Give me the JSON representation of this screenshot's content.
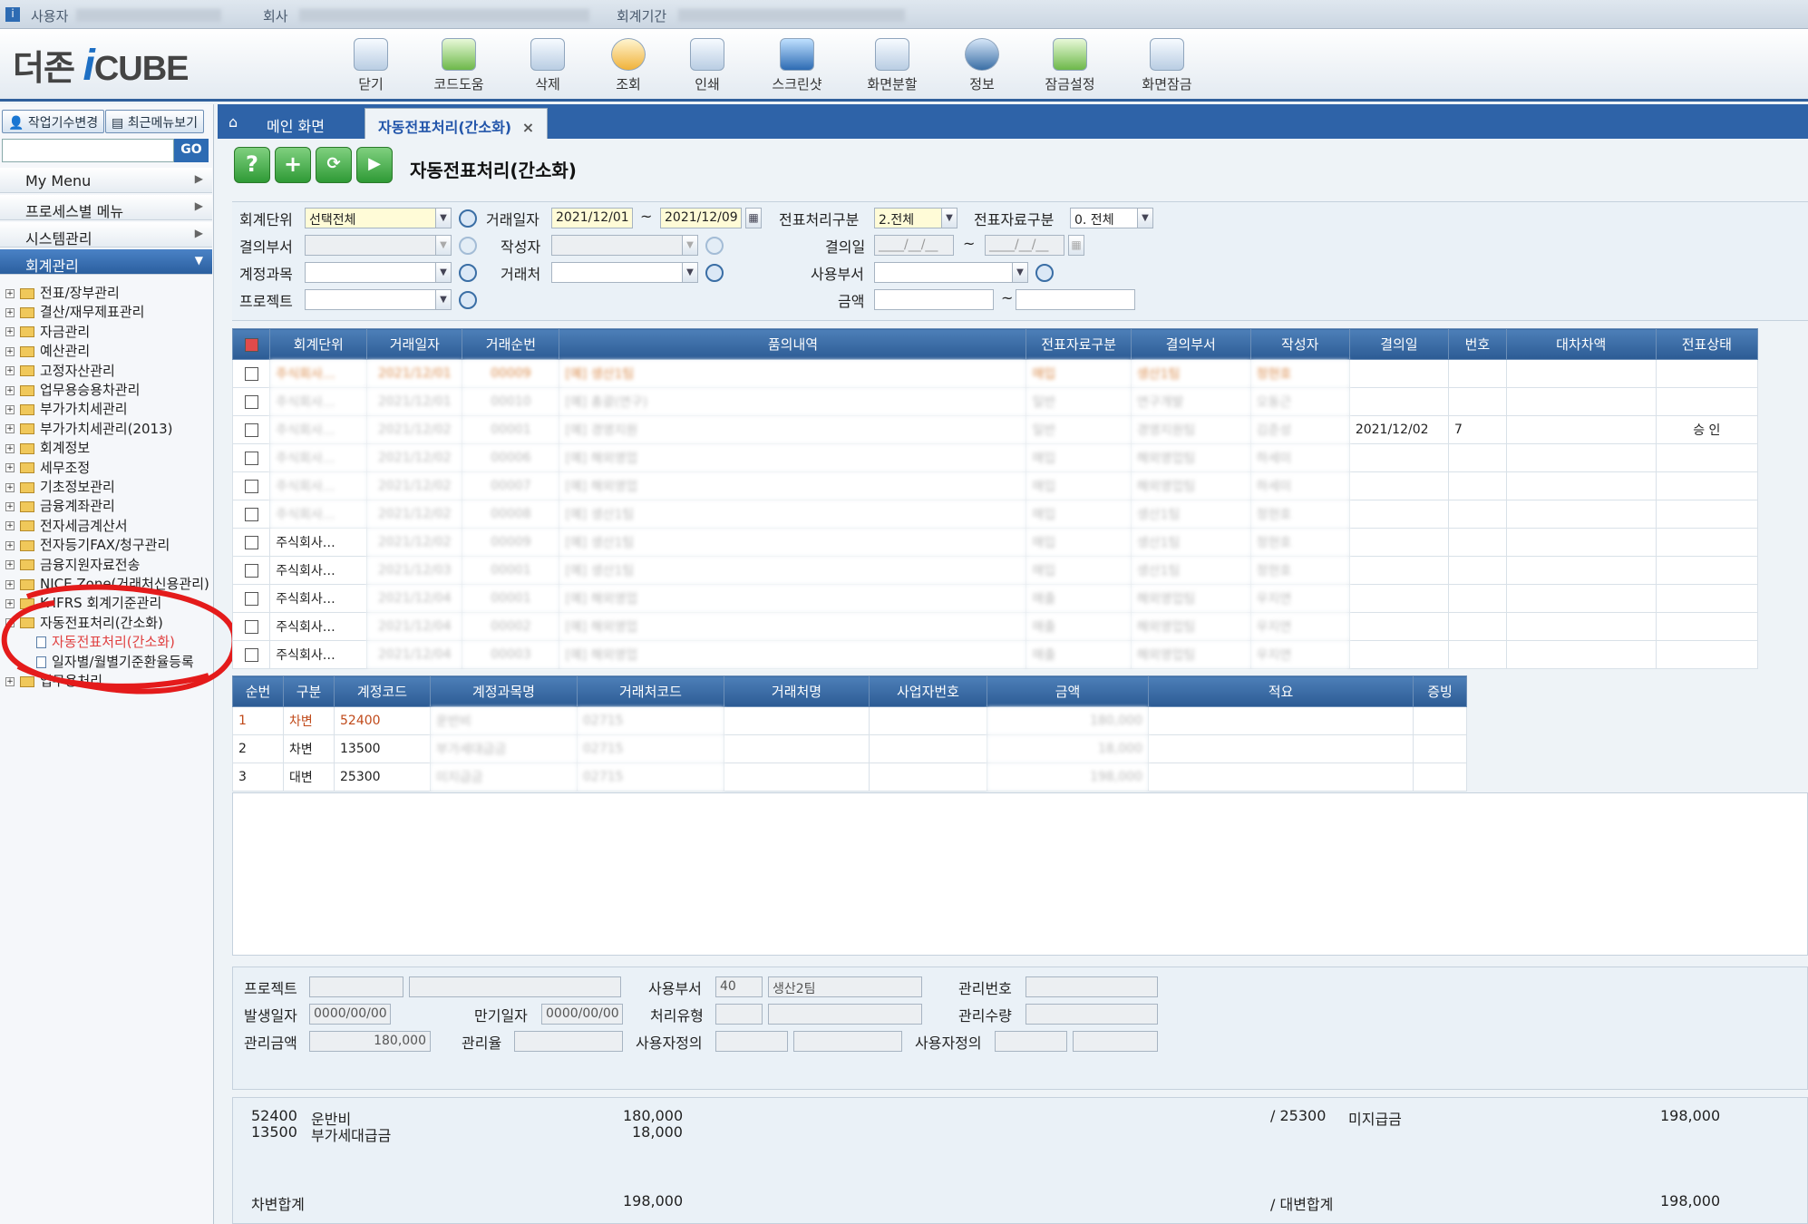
{
  "window": {
    "title_segments": [
      "사용자",
      "회사",
      "회계기간"
    ]
  },
  "toolbar": {
    "logo_prefix": "더존",
    "logo_i": "i",
    "logo_suffix": "CUBE",
    "buttons": [
      "닫기",
      "코드도움",
      "삭제",
      "조회",
      "인쇄",
      "스크린샷",
      "화면분할",
      "정보",
      "잠금설정",
      "화면잠금"
    ]
  },
  "sidebar": {
    "change_period_label": "작업기수변경",
    "recent_menu_label": "최근메뉴보기",
    "go_label": "GO",
    "menus": [
      "My Menu",
      "프로세스별 메뉴",
      "시스템관리",
      "회계관리"
    ],
    "tree": [
      "전표/장부관리",
      "결산/재무제표관리",
      "자금관리",
      "예산관리",
      "고정자산관리",
      "업무용승용차관리",
      "부가가치세관리",
      "부가가치세관리(2013)",
      "회계정보",
      "세무조정",
      "기초정보관리",
      "금융계좌관리",
      "전자세금계산서",
      "전자등기FAX/청구관리",
      "금융지원자료전송",
      "NICE Zone(거래처신용관리)",
      "K-IFRS 회계기준관리",
      "자동전표처리(간소화)",
      "자동전표처리(간소화)",
      "일자별/월별기준환율등록",
      "업무용처리"
    ]
  },
  "tabs": {
    "home": "메인 화면",
    "active": "자동전표처리(간소화)",
    "close": "×"
  },
  "form": {
    "title": "자동전표처리(간소화)"
  },
  "filter": {
    "unit_label": "회계단위",
    "unit_value": "선택전체",
    "date_label": "거래일자",
    "date_from": "2021/12/01",
    "date_to": "2021/12/09",
    "proc_label": "전표처리구분",
    "proc_value": "2.전체",
    "src_label": "전표자료구분",
    "src_value": "0. 전체",
    "dept_label": "결의부서",
    "writer_label": "작성자",
    "decide_label": "결의일",
    "decide_from": "____/__/__",
    "decide_to": "____/__/__",
    "acct_label": "계정과목",
    "partner_label": "거래처",
    "use_dept_label": "사용부서",
    "project_label": "프로젝트",
    "amount_label": "금액",
    "tilde": "~"
  },
  "grid1": {
    "headers": [
      "",
      "회계단위",
      "거래일자",
      "거래순번",
      "품의내역",
      "전표자료구분",
      "결의부서",
      "작성자",
      "결의일",
      "번호",
      "대차차액",
      "전표상태"
    ],
    "rows": [
      [
        "주식회사…",
        "2021/12/01",
        "00009",
        "[예] 생산1팀",
        "매입",
        "생산1팀",
        "정현호",
        "",
        "",
        "",
        ""
      ],
      [
        "주식회사…",
        "2021/12/01",
        "00010",
        "[예] 총괄(연구)",
        "일반",
        "연구개발",
        "오동근",
        "",
        "",
        "",
        ""
      ],
      [
        "주식회사…",
        "2021/12/02",
        "00001",
        "[예] 경영지원",
        "일반",
        "경영지원팀",
        "김준성",
        "2021/12/02",
        "7",
        "",
        "승 인"
      ],
      [
        "주식회사…",
        "2021/12/02",
        "00006",
        "[예] 해외영업",
        "매입",
        "해외영업팀",
        "하세미",
        "",
        "",
        "",
        ""
      ],
      [
        "주식회사…",
        "2021/12/02",
        "00007",
        "[예] 해외영업",
        "매입",
        "해외영업팀",
        "하세미",
        "",
        "",
        "",
        ""
      ],
      [
        "주식회사…",
        "2021/12/02",
        "00008",
        "[예] 생산1팀",
        "매입",
        "생산1팀",
        "정현호",
        "",
        "",
        "",
        ""
      ],
      [
        "주식회사…",
        "2021/12/02",
        "00009",
        "[예] 생산1팀",
        "매입",
        "생산1팀",
        "정현호",
        "",
        "",
        "",
        ""
      ],
      [
        "주식회사…",
        "2021/12/03",
        "00001",
        "[예] 생산1팀",
        "매입",
        "생산1팀",
        "정현호",
        "",
        "",
        "",
        ""
      ],
      [
        "주식회사…",
        "2021/12/04",
        "00001",
        "[예] 해외영업",
        "매출",
        "해외영업팀",
        "우지연",
        "",
        "",
        "",
        ""
      ],
      [
        "주식회사…",
        "2021/12/04",
        "00002",
        "[예] 해외영업",
        "매출",
        "해외영업팀",
        "우지연",
        "",
        "",
        "",
        ""
      ],
      [
        "주식회사…",
        "2021/12/04",
        "00003",
        "[예] 해외영업",
        "매출",
        "해외영업팀",
        "우지연",
        "",
        "",
        "",
        ""
      ]
    ]
  },
  "grid2": {
    "headers": [
      "순번",
      "구분",
      "계정코드",
      "계정과목명",
      "거래처코드",
      "거래처명",
      "사업자번호",
      "금액",
      "적요",
      "증빙"
    ],
    "rows": [
      [
        "1",
        "차변",
        "52400",
        "운반비",
        "02715",
        "",
        "",
        "180,000",
        "",
        ""
      ],
      [
        "2",
        "차변",
        "13500",
        "부가세대급금",
        "02715",
        "",
        "",
        "18,000",
        "",
        ""
      ],
      [
        "3",
        "대변",
        "25300",
        "미지급금",
        "02715",
        "",
        "",
        "198,000",
        "",
        ""
      ]
    ]
  },
  "info": {
    "project_label": "프로젝트",
    "use_dept_label": "사용부서",
    "use_dept_code": "40",
    "use_dept_name": "생산2팀",
    "mgmt_no_label": "관리번호",
    "occur_label": "발생일자",
    "occur_value": "0000/00/00",
    "due_label": "만기일자",
    "due_value": "0000/00/00",
    "proc_type_label": "처리유형",
    "mgmt_qty_label": "관리수량",
    "mgmt_amt_label": "관리금액",
    "mgmt_amt_value": "180,000",
    "mgmt_rate_label": "관리율",
    "user_def_label": "사용자정의"
  },
  "summary": {
    "d1_code": "52400",
    "d1_name": "운반비",
    "d1_amt": "180,000",
    "d2_code": "13500",
    "d2_name": "부가세대급금",
    "d2_amt": "18,000",
    "c1_code": "/ 25300",
    "c1_name": "미지급금",
    "c1_amt": "198,000",
    "debit_total_label": "차변합계",
    "debit_total": "198,000",
    "credit_total_label": "/ 대변합계",
    "credit_total": "198,000"
  },
  "colors": {
    "accent": "#2e63a8",
    "highlight_row": "#fcd8a8",
    "annotation": "#e41b1b"
  }
}
